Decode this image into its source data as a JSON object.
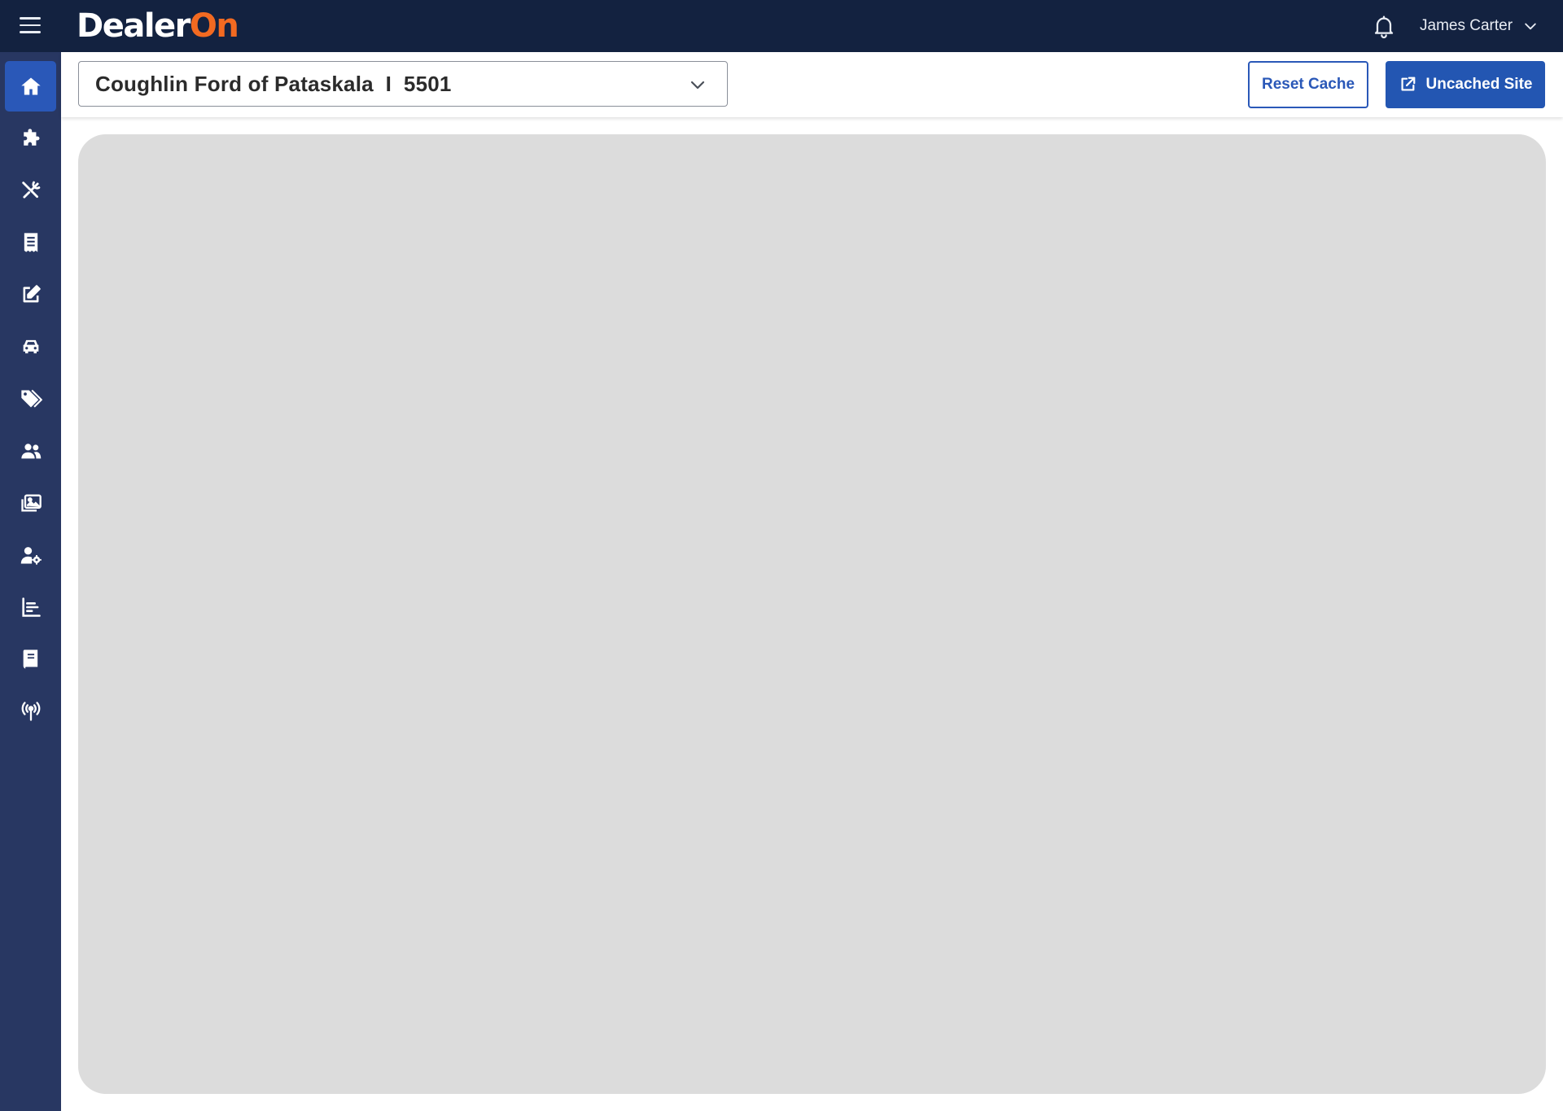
{
  "app": {
    "logo_part1": "Dealer",
    "logo_part2": "On",
    "brand_accent": "#f26a21",
    "topbar_color": "#132240",
    "sidebar_color": "#283762",
    "primary_color": "#2a58b8"
  },
  "topbar": {
    "user_name": "James Carter",
    "icons": [
      "menu-icon",
      "bell-icon",
      "chevron-down-icon"
    ]
  },
  "sidebar": {
    "items": [
      {
        "icon": "home-icon",
        "active": true
      },
      {
        "icon": "puzzle-icon",
        "active": false
      },
      {
        "icon": "tools-icon",
        "active": false
      },
      {
        "icon": "receipt-icon",
        "active": false
      },
      {
        "icon": "edit-icon",
        "active": false
      },
      {
        "icon": "car-icon",
        "active": false
      },
      {
        "icon": "tags-icon",
        "active": false
      },
      {
        "icon": "users-icon",
        "active": false
      },
      {
        "icon": "images-icon",
        "active": false
      },
      {
        "icon": "user-settings-icon",
        "active": false
      },
      {
        "icon": "bar-chart-icon",
        "active": false
      },
      {
        "icon": "book-icon",
        "active": false
      },
      {
        "icon": "broadcast-icon",
        "active": false
      }
    ]
  },
  "header": {
    "site_selector_value": "Coughlin Ford of Pataskala  I  5501",
    "reset_cache_label": "Reset Cache",
    "uncached_site_label": "Uncached Site"
  },
  "content": {
    "panel_color": "#dcdcdc"
  }
}
